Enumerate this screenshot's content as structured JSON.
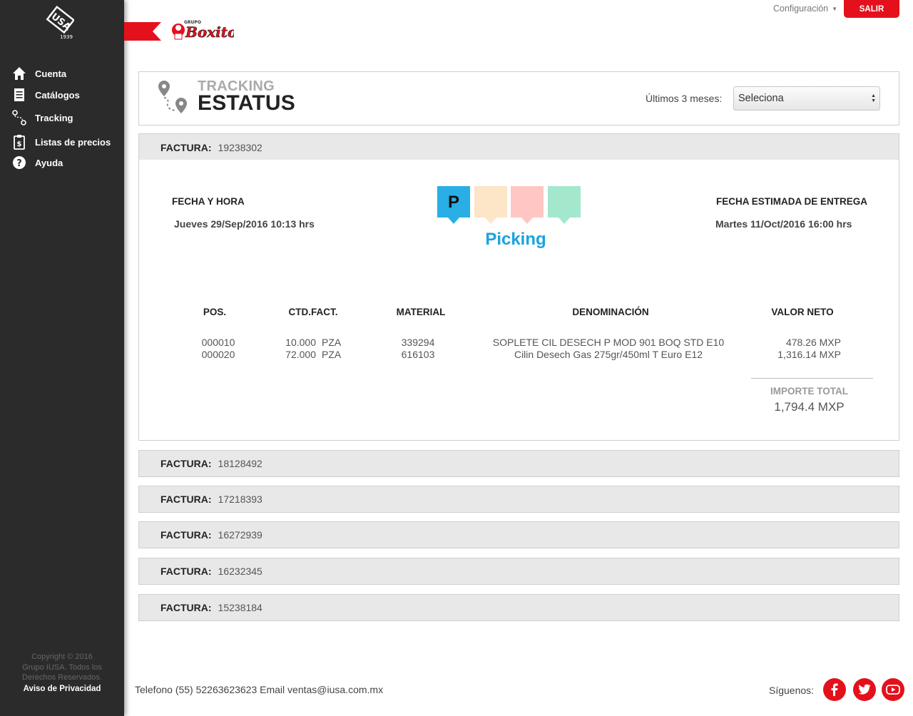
{
  "sidebar": {
    "logo": {
      "alt": "IUSA 1939",
      "year": "1939"
    },
    "items": [
      {
        "label": "Cuenta",
        "icon": "home-icon"
      },
      {
        "label": "Catálogos",
        "icon": "catalog-icon"
      },
      {
        "label": "Tracking",
        "icon": "route-icon"
      },
      {
        "label": "Listas de precios",
        "icon": "price-list-icon"
      },
      {
        "label": "Ayuda",
        "icon": "help-icon"
      }
    ],
    "copyright": [
      "Copyright © 2016",
      "Grupo IUSA. Todos los",
      "Derechos Reservados."
    ],
    "privacy_link": "Aviso de Privacidad"
  },
  "topbar": {
    "brand": "Grupo Boxito",
    "config_label": "Configuración",
    "logout_label": "SALIR"
  },
  "header": {
    "subtitle": "TRACKING",
    "title": "ESTATUS",
    "period_label": "Últimos 3 meses:",
    "period_select_value": "Seleciona"
  },
  "invoice_label": "FACTURA:",
  "expanded_invoice": {
    "number": "19238302",
    "date_heading": "FECHA Y HORA",
    "date_value": "Jueves 29/Sep/2016 10:13 hrs",
    "eta_heading": "FECHA ESTIMADA DE ENTREGA",
    "eta_value": "Martes 11/Oct/2016 16:00 hrs",
    "status_steps": [
      {
        "letter": "P",
        "color": "#29aee6",
        "active": true
      },
      {
        "letter": "",
        "color": "#fde5c8",
        "active": false
      },
      {
        "letter": "",
        "color": "#ffc6c3",
        "active": false
      },
      {
        "letter": "",
        "color": "#a3e8cd",
        "active": false
      }
    ],
    "status_label": "Picking",
    "columns": [
      "POS.",
      "CTD.FACT.",
      "MATERIAL",
      "DENOMINACIÓN",
      "VALOR NETO"
    ],
    "rows": [
      {
        "pos": "000010",
        "qty": "10.000",
        "unit": "PZA",
        "material": "339294",
        "description": "SOPLETE CIL DESECH P MOD 901 BOQ STD E10",
        "value": "478.26 MXP"
      },
      {
        "pos": "000020",
        "qty": "72.000",
        "unit": "PZA",
        "material": "616103",
        "description": "Cilin Desech Gas 275gr/450ml T Euro E12",
        "value": "1,316.14 MXP"
      }
    ],
    "total_label": "IMPORTE TOTAL",
    "total_value": "1,794.4 MXP"
  },
  "other_invoices": [
    "18128492",
    "17218393",
    "16272939",
    "16232345",
    "15238184"
  ],
  "footer": {
    "contact": "Telefono (55) 52263623623  Email ventas@iusa.com.mx",
    "follow_label": "Síguenos:",
    "social": [
      "facebook-icon",
      "twitter-icon",
      "youtube-icon"
    ]
  },
  "colors": {
    "sidebar": "#2b2b2b",
    "accent": "#e4111d",
    "status_blue": "#1aa3de"
  }
}
